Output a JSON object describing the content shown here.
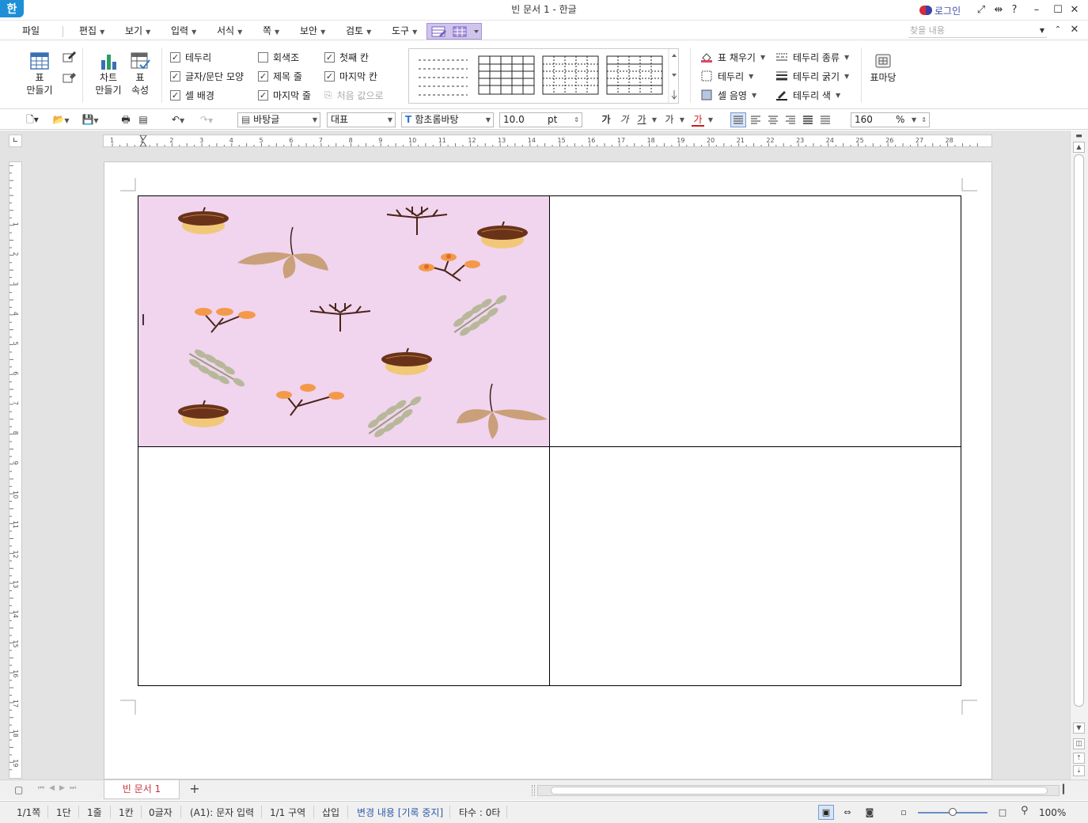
{
  "app": {
    "logo": "한",
    "title": "빈 문서 1 - 한글",
    "login": "로그인",
    "find_placeholder": "찾을 내용"
  },
  "menu": {
    "file": "파일",
    "items": [
      {
        "label": "편집"
      },
      {
        "label": "보기"
      },
      {
        "label": "입력"
      },
      {
        "label": "서식"
      },
      {
        "label": "쪽"
      },
      {
        "label": "보안"
      },
      {
        "label": "검토"
      },
      {
        "label": "도구"
      }
    ]
  },
  "ribbon": {
    "table_make": [
      "표",
      "만들기"
    ],
    "chart_make": [
      "차트",
      "만들기"
    ],
    "table_props": [
      "표",
      "속성"
    ],
    "checks": [
      {
        "label": "테두리",
        "checked": true
      },
      {
        "label": "글자/문단 모양",
        "checked": true
      },
      {
        "label": "셀 배경",
        "checked": true
      },
      {
        "label": "회색조",
        "checked": false
      },
      {
        "label": "제목 줄",
        "checked": true
      },
      {
        "label": "마지막 줄",
        "checked": true
      },
      {
        "label": "첫째 칸",
        "checked": true
      },
      {
        "label": "마지막 칸",
        "checked": true
      },
      {
        "label": "처음 값으로",
        "checked": false
      }
    ],
    "right_opts": [
      "표 채우기",
      "테두리",
      "셀 음영",
      "테두리 종류",
      "테두리 굵기",
      "테두리 색"
    ],
    "table_ma": "표마당"
  },
  "toolbar": {
    "style": "바탕글",
    "lang": "대표",
    "font": "함초롬바탕",
    "size": "10.0",
    "size_unit": "pt",
    "bold": "가",
    "italic": "가",
    "underline": "가",
    "strike": "가",
    "color": "가",
    "line_spacing": "160",
    "line_spacing_unit": "%"
  },
  "ruler": {
    "h_ticks": [
      "1",
      "1",
      "2",
      "3",
      "4",
      "5",
      "6",
      "7",
      "8",
      "9",
      "10",
      "11",
      "12",
      "13",
      "14",
      "15",
      "16",
      "17",
      "18",
      "19",
      "20",
      "21",
      "22",
      "23",
      "24",
      "25",
      "26",
      "27",
      "28"
    ],
    "v_ticks": [
      "1",
      "2",
      "3",
      "4",
      "5",
      "6",
      "7",
      "8",
      "9",
      "10",
      "11",
      "12",
      "13",
      "14",
      "15",
      "16",
      "17",
      "18",
      "19"
    ]
  },
  "document": {
    "tab": "빈 문서 1",
    "cell_bg": "#f1d4ee"
  },
  "status": {
    "page": "1/1쪽",
    "column": "1단",
    "line": "1줄",
    "cell": "1칸",
    "chars": "0글자",
    "cell_input": "(A1): 문자 입력",
    "section": "1/1 구역",
    "mode": "삽입",
    "track": "변경 내용 [기록 중지]",
    "typing": "타수 : 0타",
    "zoom": "100%"
  },
  "colors": {
    "accent": "#1e8fd6",
    "tab_active": "#c8323c",
    "status_link": "#2e5aa8"
  }
}
